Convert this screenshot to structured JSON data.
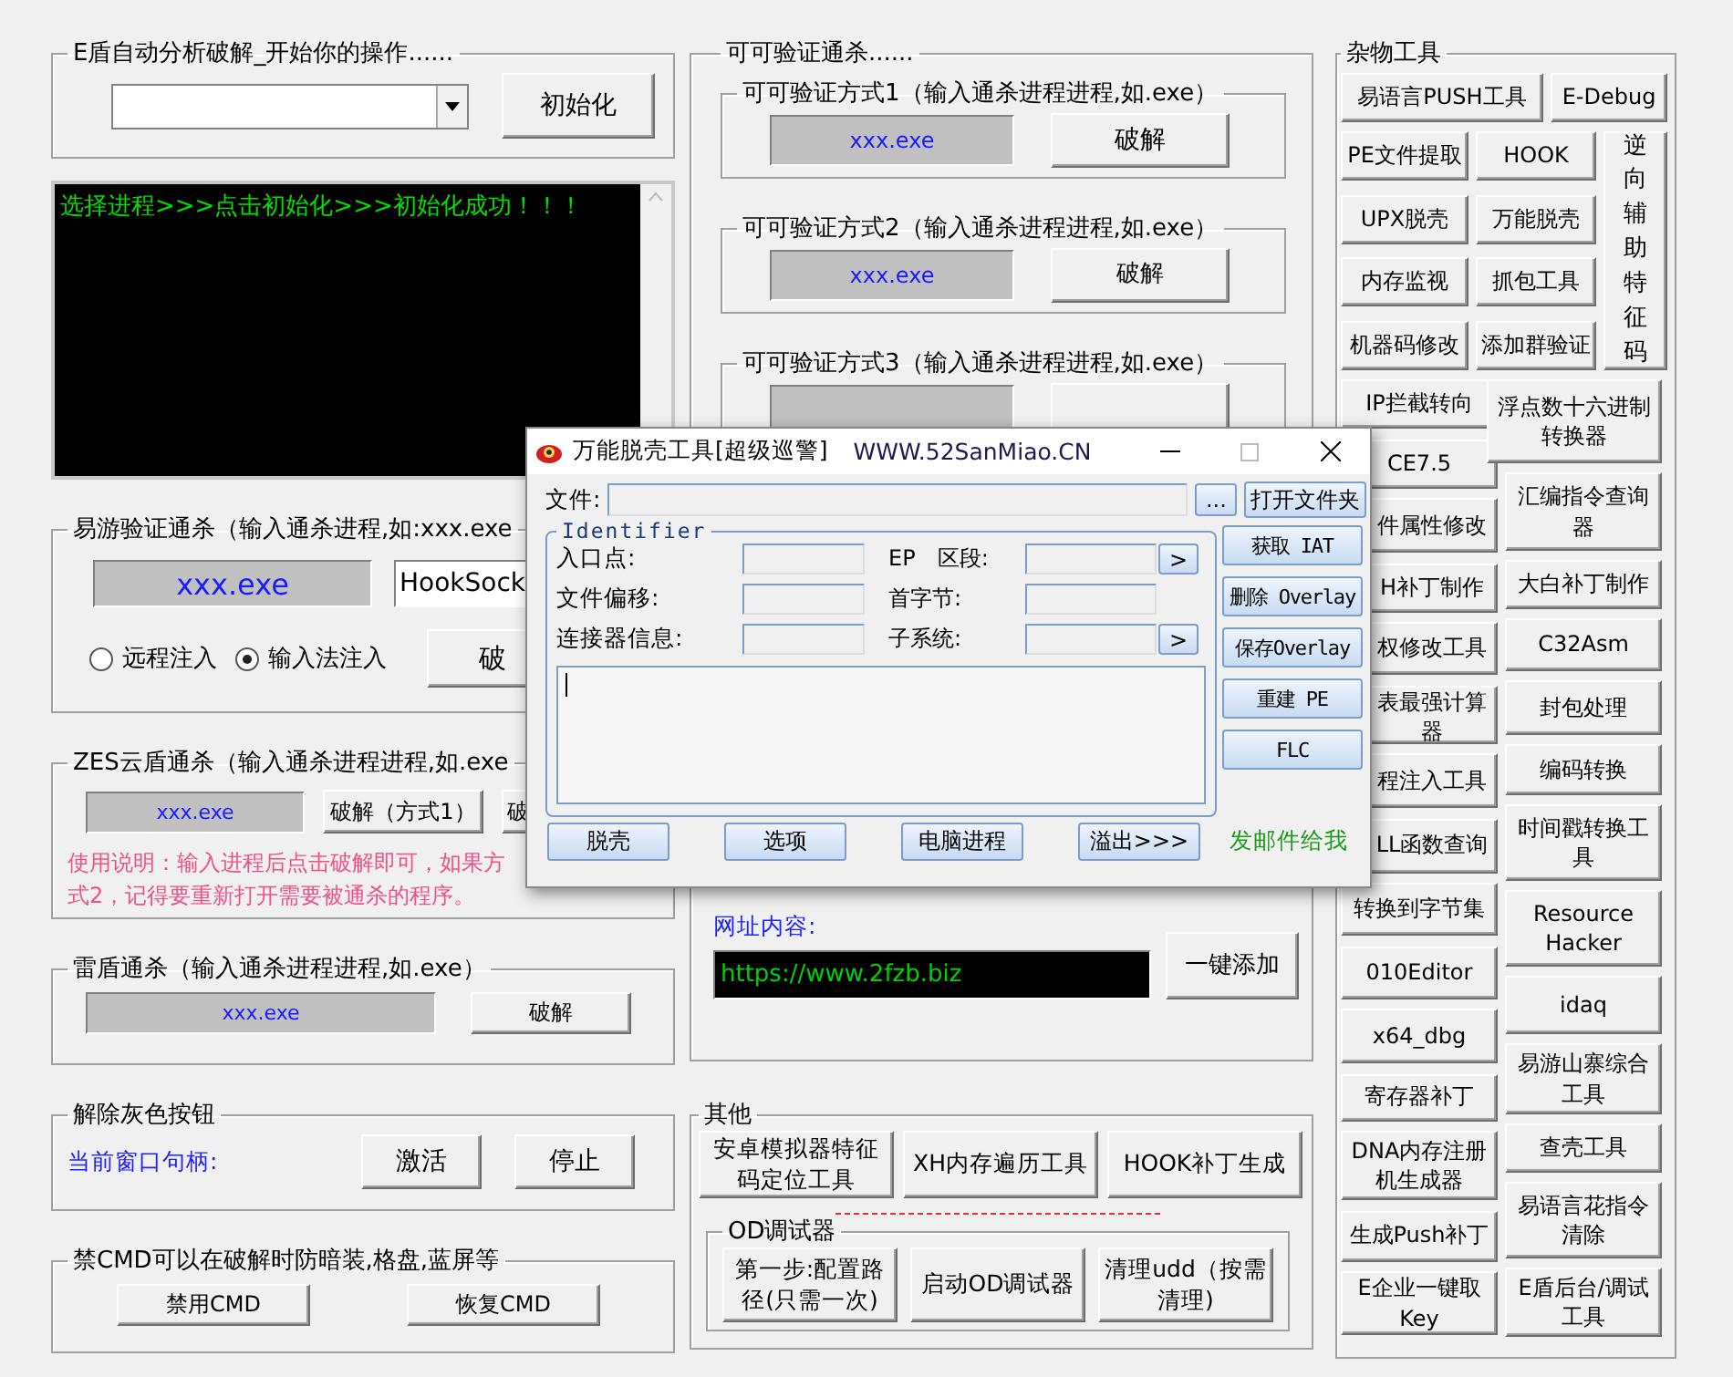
{
  "left": {
    "edun": {
      "title": "E盾自动分析破解_开始你的操作......",
      "button": "初始化"
    },
    "log": {
      "text": "选择进程>>>点击初始化>>>初始化成功！！！"
    },
    "yiyou": {
      "title": "易游验证通杀（输入通杀进程,如:xxx.exe",
      "process": "xxx.exe",
      "dll": "HookSock",
      "button": "破",
      "modes": [
        {
          "label": "远程注入",
          "selected": false
        },
        {
          "label": "输入法注入",
          "selected": true
        }
      ]
    },
    "zes": {
      "title": "ZES云盾通杀（输入通杀进程进程,如.exe",
      "process": "xxx.exe",
      "buttons": [
        "破解（方式1）",
        "破"
      ],
      "note": [
        "使用说明：输入进程后点击破解即可，如果方",
        "式2，记得要重新打开需要被通杀的程序。"
      ]
    },
    "leidun": {
      "title": "雷盾通杀（输入通杀进程进程,如.exe）",
      "process": "xxx.exe",
      "button": "破解"
    },
    "ungray": {
      "title": "解除灰色按钮",
      "handle_label": "当前窗口句柄:",
      "buttons": [
        "激活",
        "停止"
      ]
    },
    "cmd": {
      "title": "禁CMD可以在破解时防暗装,格盘,蓝屏等",
      "buttons": [
        "禁用CMD",
        "恢复CMD"
      ]
    }
  },
  "middle": {
    "keke": {
      "title": "可可验证通杀......",
      "methods": [
        {
          "title": "可可验证方式1（输入通杀进程进程,如.exe）",
          "process": "xxx.exe",
          "button": "破解"
        },
        {
          "title": "可可验证方式2（输入通杀进程进程,如.exe）",
          "process": "xxx.exe",
          "button": "破解"
        },
        {
          "title": "可可验证方式3（输入通杀进程进程,如.exe）"
        }
      ],
      "url_label": "网址内容:",
      "url": "https://www.2fzb.biz",
      "add_button": "一键添加"
    },
    "other": {
      "title": "其他",
      "buttons": [
        "安卓模拟器特征码定位工具",
        "XH内存遍历工具",
        "HOOK补丁生成"
      ],
      "od": {
        "title": "OD调试器",
        "buttons": [
          "第一步:配置路径(只需一次)",
          "启动OD调试器",
          "清理udd（按需清理)"
        ]
      }
    }
  },
  "tools": {
    "title": "杂物工具",
    "top": [
      "易语言PUSH工具",
      "E-Debug"
    ],
    "grid": [
      "PE文件提取",
      "HOOK",
      "UPX脱壳",
      "万能脱壳",
      "内存监视",
      "抓包工具",
      "机器码修改",
      "添加群验证"
    ],
    "tall": "逆向辅助特征码",
    "left": [
      "IP拦截转向",
      "CE7.5",
      "件属性修改",
      "H补丁制作",
      "权修改工具",
      "表最强计算器",
      "程注入工具",
      "LL函数查询",
      "转换到字节集",
      "010Editor",
      "x64_dbg",
      "寄存器补丁",
      "DNA内存注册机生成器",
      "生成Push补丁",
      "E企业一键取Key"
    ],
    "right": [
      "浮点数十六进制转换器",
      "汇编指令查询器",
      "大白补丁制作",
      "C32Asm",
      "封包处理",
      "编码转换",
      "时间戳转换工具",
      "Resource Hacker",
      "idaq",
      "易游山寨综合工具",
      "查壳工具",
      "易语言花指令清除",
      "E盾后台/调试工具"
    ]
  },
  "dialog": {
    "title": "万能脱壳工具[超级巡警]",
    "site": "WWW.52SanMiao.CN",
    "file_label": "文件:",
    "browse": "...",
    "open_folder": "打开文件夹",
    "group": "Identifier",
    "fields": [
      {
        "label": "入口点:"
      },
      {
        "label": "EP　区段:",
        "arrow": ">"
      },
      {
        "label": "文件偏移:"
      },
      {
        "label": "首字节:"
      },
      {
        "label": "连接器信息:"
      },
      {
        "label": "子系统:",
        "arrow": ">"
      }
    ],
    "side_buttons": [
      "获取 IAT",
      "删除 Overlay",
      "保存Overlay",
      "重建 PE",
      "FLC"
    ],
    "bottom_buttons": [
      "脱壳",
      "选项",
      "电脑进程",
      "溢出>>>"
    ],
    "mail": "发邮件给我"
  }
}
